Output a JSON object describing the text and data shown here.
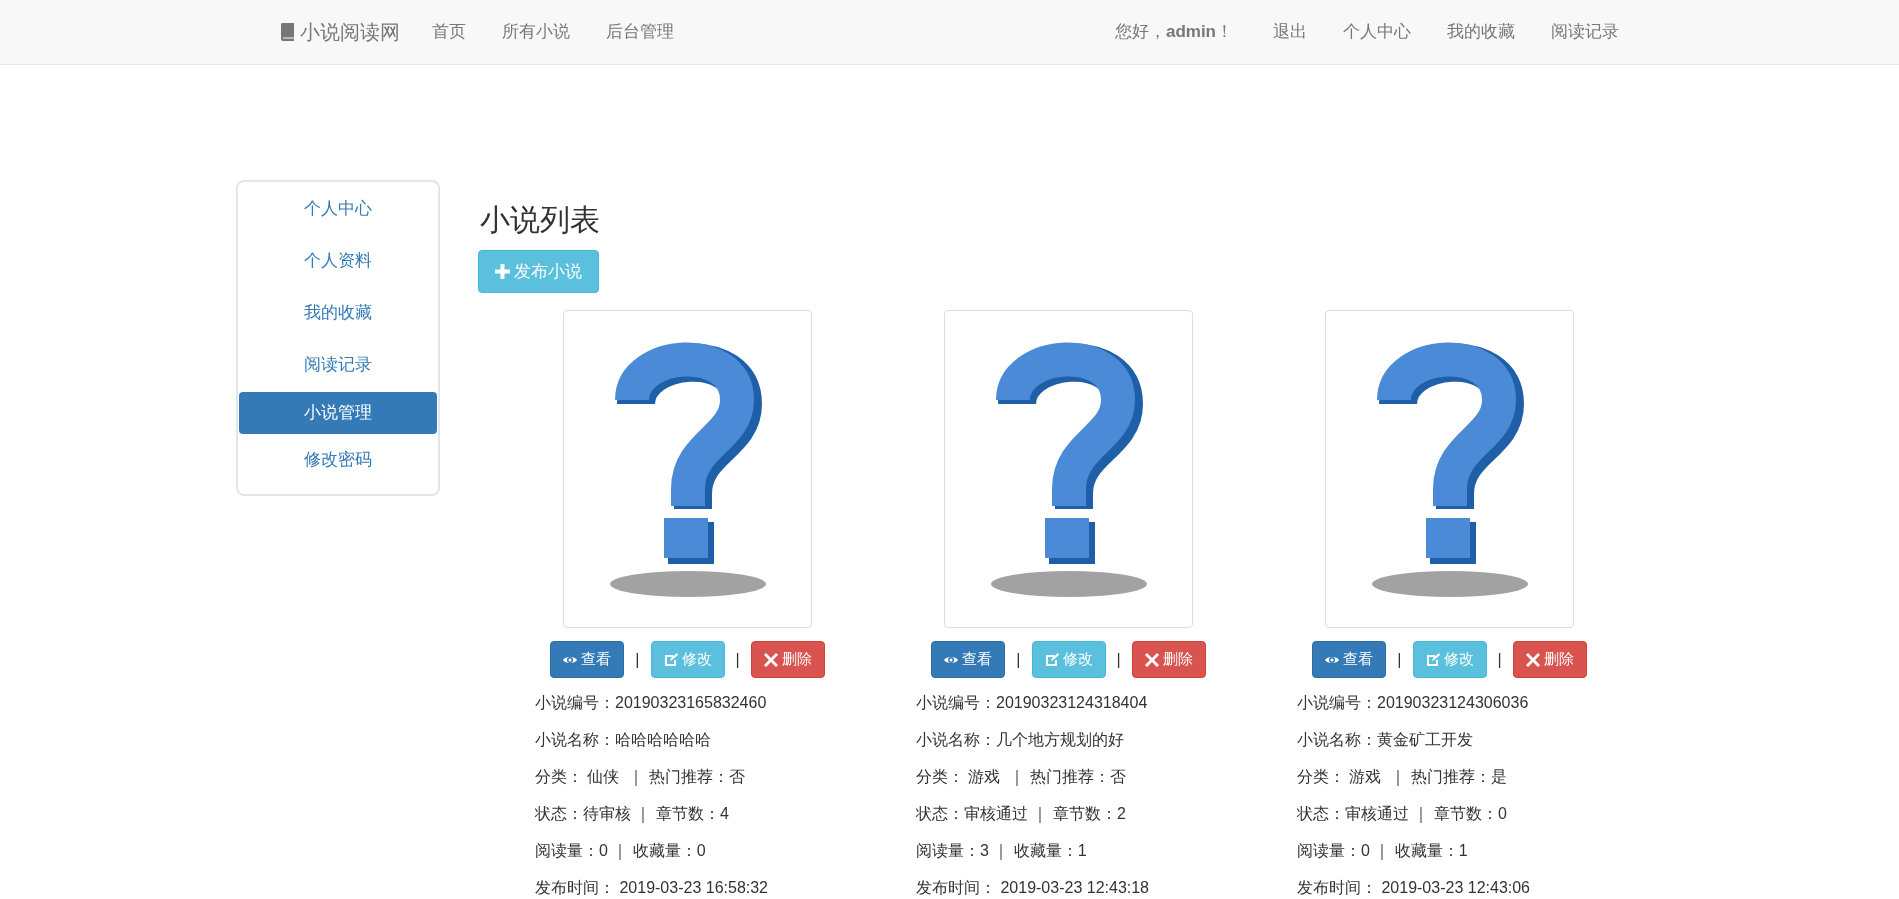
{
  "navbar": {
    "brand": "小说阅读网",
    "left_links": [
      "首页",
      "所有小说",
      "后台管理"
    ],
    "greeting": "您好，**admin**！",
    "right_links": [
      "退出",
      "个人中心",
      "我的收藏",
      "阅读记录"
    ]
  },
  "sidebar": {
    "items": [
      {
        "label": "个人中心",
        "selected": false
      },
      {
        "label": "个人资料",
        "selected": false
      },
      {
        "label": "我的收藏",
        "selected": false
      },
      {
        "label": "阅读记录",
        "selected": false
      },
      {
        "label": "小说管理",
        "selected": true
      },
      {
        "label": "修改密码",
        "selected": false
      }
    ]
  },
  "main": {
    "title": "小说列表",
    "publish_button": "发布小说",
    "novels": [
      {
        "actions": [
          {
            "kind": "view",
            "label": "查看"
          },
          {
            "kind": "edit",
            "label": "修改"
          },
          {
            "kind": "delete",
            "label": "删除"
          }
        ],
        "separator": "|",
        "lines": [
          "小说编号：20190323165832460",
          "小说名称：哈哈哈哈哈哈",
          "分类： 仙侠  ｜ 热门推荐：否",
          "状态：待审核 ｜ 章节数：4",
          "阅读量：0 ｜ 收藏量：0",
          "发布时间： 2019-03-23 16:58:32"
        ]
      },
      {
        "actions": [
          {
            "kind": "view",
            "label": "查看"
          },
          {
            "kind": "edit",
            "label": "修改"
          },
          {
            "kind": "delete",
            "label": "删除"
          }
        ],
        "separator": "|",
        "lines": [
          "小说编号：20190323124318404",
          "小说名称：几个地方规划的好",
          "分类： 游戏  ｜ 热门推荐：否",
          "状态：审核通过 ｜ 章节数：2",
          "阅读量：3 ｜ 收藏量：1",
          "发布时间： 2019-03-23 12:43:18"
        ]
      },
      {
        "actions": [
          {
            "kind": "view",
            "label": "查看"
          },
          {
            "kind": "edit",
            "label": "修改"
          },
          {
            "kind": "delete",
            "label": "删除"
          }
        ],
        "separator": "|",
        "lines": [
          "小说编号：20190323124306036",
          "小说名称：黄金矿工开发",
          "分类： 游戏  ｜ 热门推荐：是",
          "状态：审核通过 ｜ 章节数：0",
          "阅读量：0 ｜ 收藏量：1",
          "发布时间： 2019-03-23 12:43:06"
        ]
      }
    ]
  }
}
